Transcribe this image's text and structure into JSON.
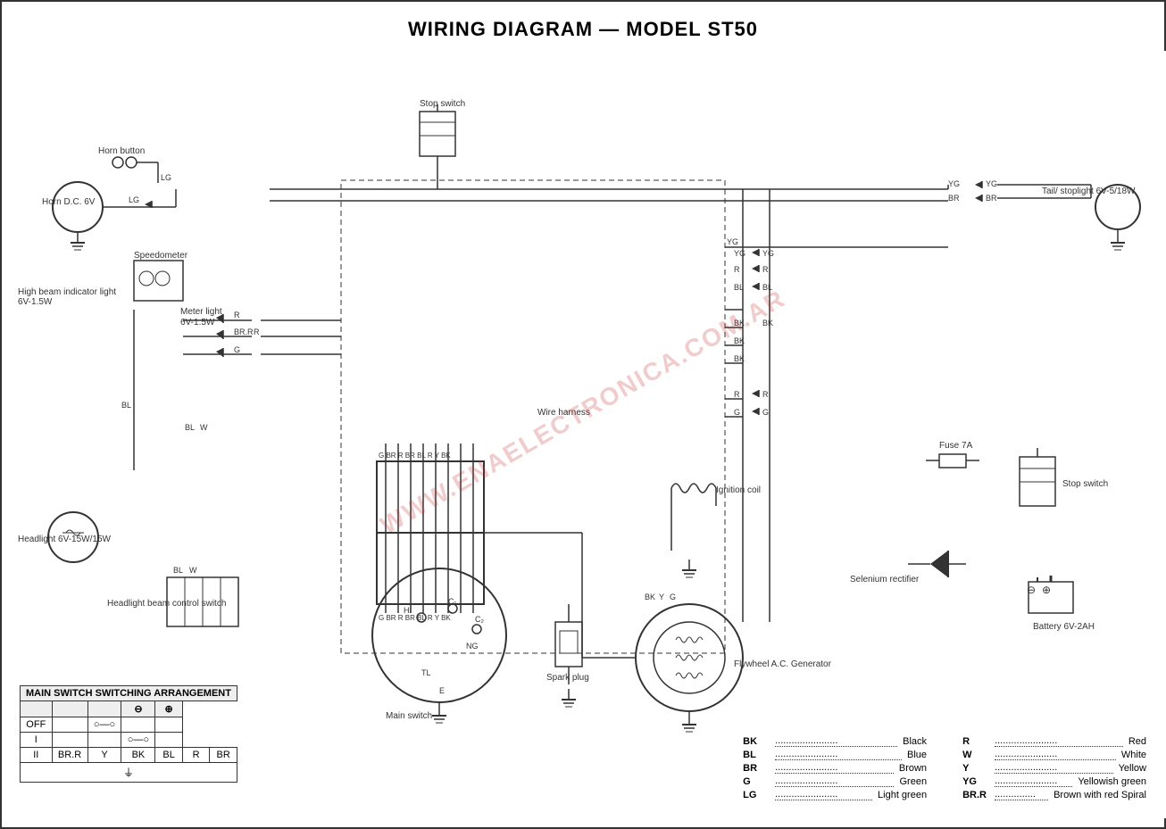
{
  "title": "WIRING DIAGRAM — MODEL ST50",
  "watermark": "WWW.ENAELECTRONICA.COM.AR",
  "legend_table": {
    "header": "MAIN SWITCH SWITCHING ARRANGEMENT",
    "columns": [
      "",
      "",
      "",
      "⊖",
      "⊕"
    ],
    "rows": [
      {
        "label": "OFF",
        "cells": [
          "",
          "",
          "○—○",
          "",
          ""
        ]
      },
      {
        "label": "I",
        "cells": [
          "",
          "",
          "",
          "○—○",
          ""
        ]
      },
      {
        "label": "II",
        "cells": [
          "BR.R",
          "Y",
          "BK",
          "BL",
          "R",
          "BR"
        ]
      }
    ]
  },
  "color_codes": [
    {
      "code": "BK",
      "name": "Black"
    },
    {
      "code": "BL",
      "name": "Blue"
    },
    {
      "code": "BR",
      "name": "Brown"
    },
    {
      "code": "G",
      "name": "Green"
    },
    {
      "code": "LG",
      "name": "Light green"
    },
    {
      "code": "R",
      "name": "Red"
    },
    {
      "code": "W",
      "name": "White"
    },
    {
      "code": "Y",
      "name": "Yellow"
    },
    {
      "code": "YG",
      "name": "Yellowish green"
    },
    {
      "code": "BR.R",
      "name": "Brown with red Spiral"
    }
  ],
  "components": {
    "horn_button": "Horn button",
    "horn_dc": "Horn D.C. 6V",
    "speedometer": "Speedometer",
    "high_beam": "High beam indicator light 6V-1.5W",
    "meter_light": "Meter light 6V-1.5W",
    "headlight": "Headlight 6V-15W/15W",
    "headlight_switch": "Headlight beam control switch",
    "stop_switch_top": "Stop switch",
    "stop_switch_right": "Stop switch",
    "tail_stoplight": "Tail/ stoplight 6V-5/18W",
    "wire_harness": "Wire harness",
    "main_switch": "Main switch",
    "spark_plug": "Spark plug",
    "flywheel": "Flywheel A.C. Generator",
    "ignition_coil": "Ignition coil",
    "fuse": "Fuse 7A",
    "selenium_rectifier": "Selenium rectifier",
    "battery": "Battery 6V-2AH"
  }
}
